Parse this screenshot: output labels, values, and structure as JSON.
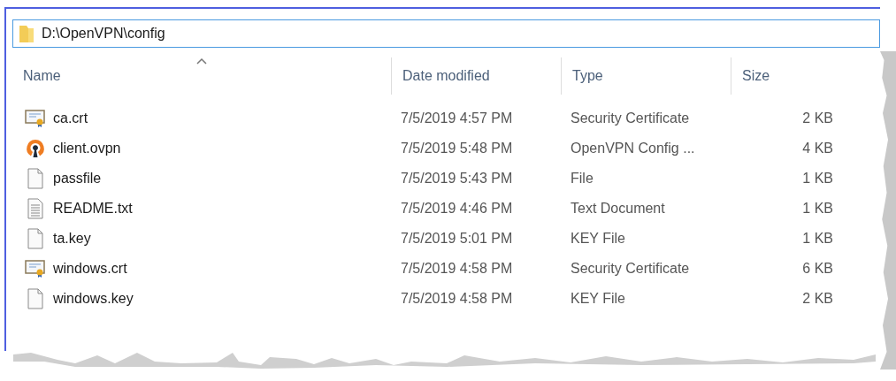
{
  "address_bar": {
    "path": "D:\\OpenVPN\\config"
  },
  "columns": [
    {
      "label": "Name",
      "sorted": true
    },
    {
      "label": "Date modified",
      "sorted": false
    },
    {
      "label": "Type",
      "sorted": false
    },
    {
      "label": "Size",
      "sorted": false
    }
  ],
  "rows": [
    {
      "kind": "certificate",
      "name": "ca.crt",
      "date": "7/5/2019 4:57 PM",
      "type": "Security Certificate",
      "size": "2 KB"
    },
    {
      "kind": "openvpn",
      "name": "client.ovpn",
      "date": "7/5/2019 5:48 PM",
      "type": "OpenVPN Config ...",
      "size": "4 KB"
    },
    {
      "kind": "blank",
      "name": "passfile",
      "date": "7/5/2019 5:43 PM",
      "type": "File",
      "size": "1 KB"
    },
    {
      "kind": "text",
      "name": "README.txt",
      "date": "7/5/2019 4:46 PM",
      "type": "Text Document",
      "size": "1 KB"
    },
    {
      "kind": "blank",
      "name": "ta.key",
      "date": "7/5/2019 5:01 PM",
      "type": "KEY File",
      "size": "1 KB"
    },
    {
      "kind": "certificate",
      "name": "windows.crt",
      "date": "7/5/2019 4:58 PM",
      "type": "Security Certificate",
      "size": "6 KB"
    },
    {
      "kind": "blank",
      "name": "windows.key",
      "date": "7/5/2019 4:58 PM",
      "type": "KEY File",
      "size": "2 KB"
    }
  ]
}
